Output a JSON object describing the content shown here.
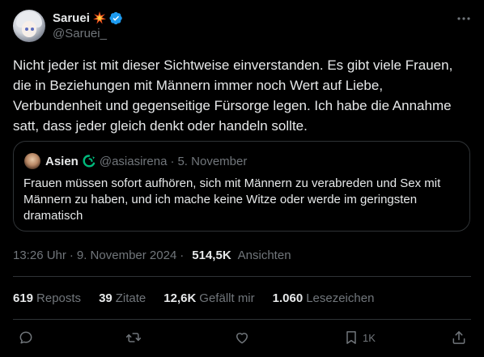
{
  "author": {
    "name": "Saruei",
    "handle": "@Saruei_",
    "verified": true,
    "badge_icon": "collision-spark-icon"
  },
  "tweet": {
    "lines": [
      "Nicht jeder ist mit dieser Sichtweise einverstanden. Es gibt viele Frauen,",
      "die in Beziehungen mit Männern immer noch Wert auf Liebe,",
      "Verbundenheit und gegenseitige Fürsorge legen. Ich habe die Annahme",
      "satt, dass jeder gleich denkt oder handeln sollte."
    ]
  },
  "quote": {
    "name": "Asien",
    "badge_icon": "ouroboros-serpent-icon",
    "handle": "@asiasirena",
    "dot": "·",
    "date": "5. November",
    "lines": [
      "Frauen müssen sofort aufhören, sich mit Männern zu verabreden und Sex mit",
      "Männern zu haben, und ich mache keine Witze oder werde im geringsten",
      "dramatisch"
    ]
  },
  "meta": {
    "time": "13:26 Uhr",
    "dot1": "·",
    "date": "9. November 2024",
    "dot2": "·",
    "views": "514,5K",
    "views_label": "Ansichten"
  },
  "stats": {
    "reposts": "619",
    "reposts_label": "Reposts",
    "quotes": "39",
    "quotes_label": "Zitate",
    "likes": "12,6K",
    "likes_label": "Gefällt mir",
    "bookmarks": "1.060",
    "bookmarks_label": "Lesezeichen"
  },
  "actions": {
    "bookmark_count": "1K"
  },
  "colors": {
    "background": "#000000",
    "text": "#e7e9ea",
    "muted": "#71767b",
    "border": "#2f3336",
    "verified_blue": "#1d9bf0",
    "serpent_green": "#00ba7c"
  }
}
